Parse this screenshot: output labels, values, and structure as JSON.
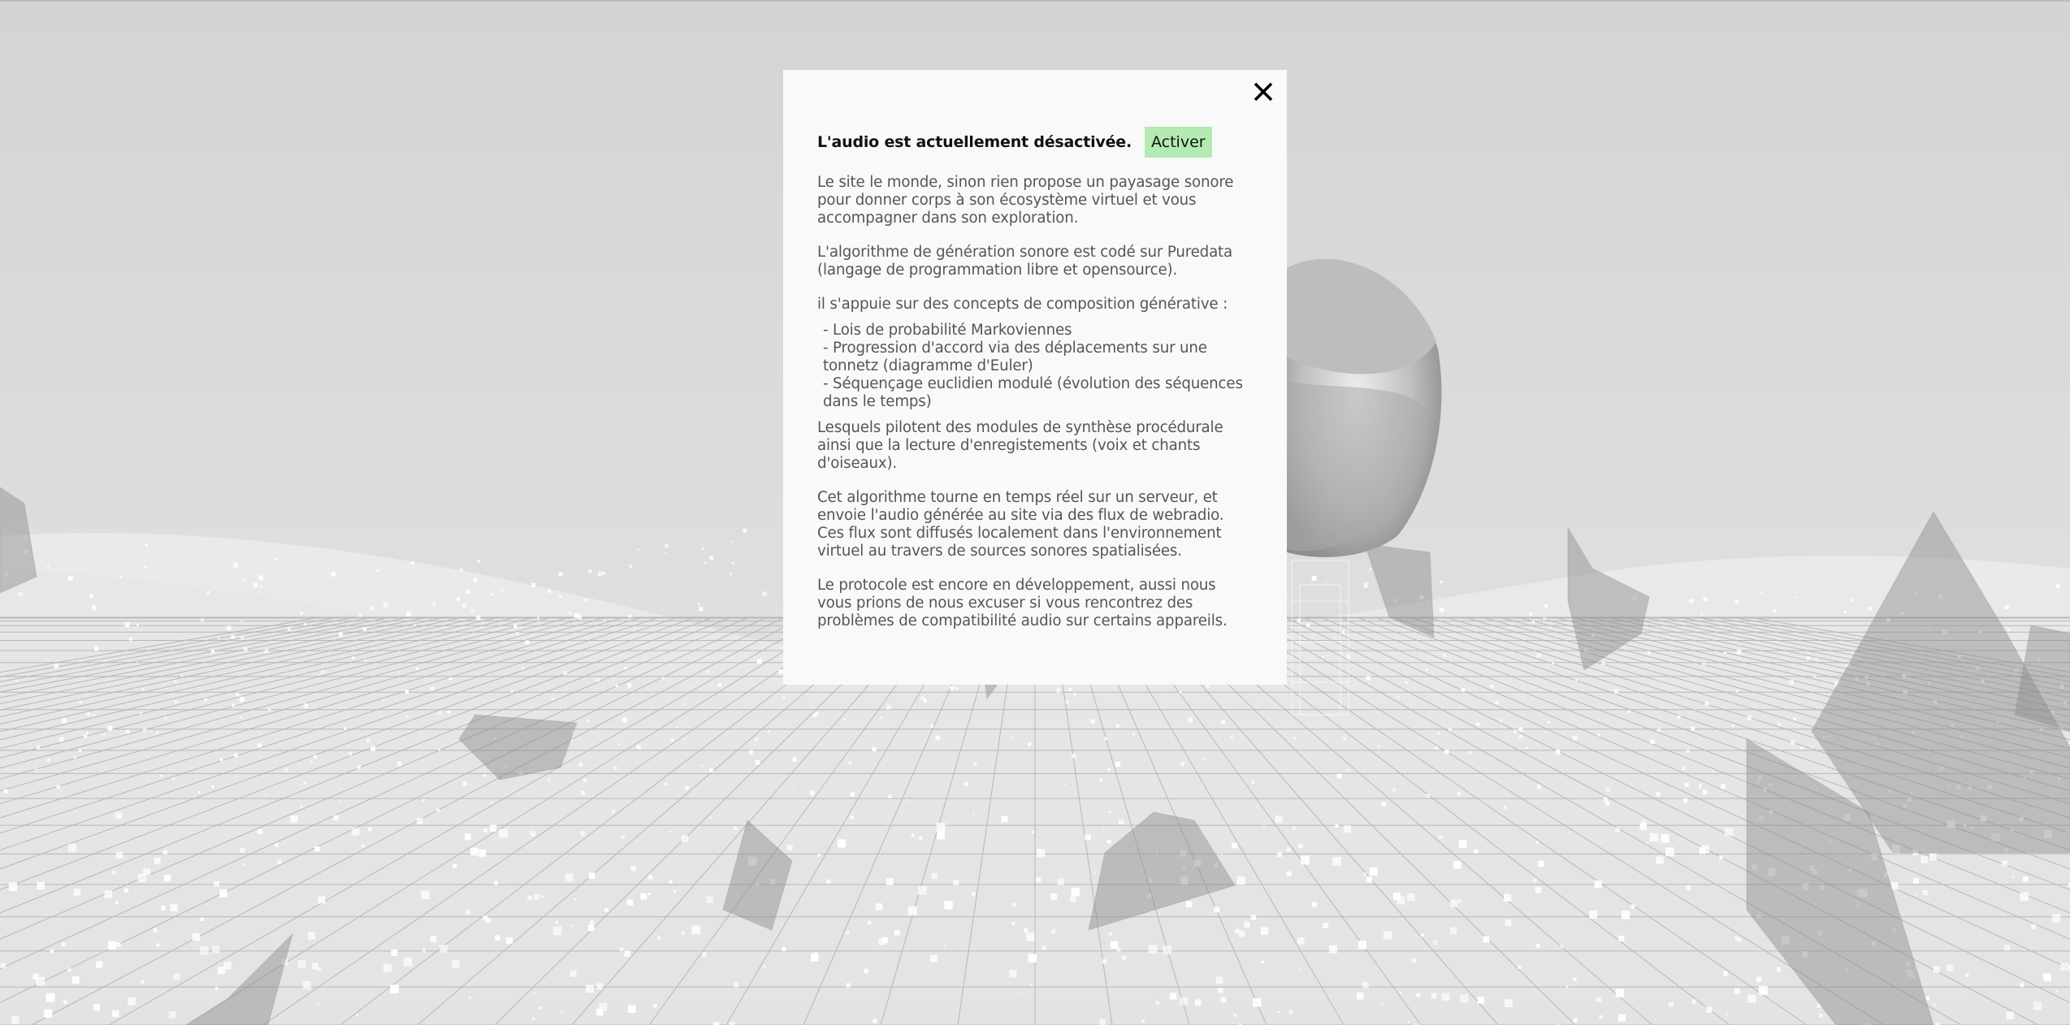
{
  "modal": {
    "close_label": "×",
    "audio_status": "L'audio est actuellement désactivée.",
    "activate_label": "Activer",
    "paragraphs": [
      "Le site le monde, sinon rien propose un payasage sonore pour donner corps à son écosystème virtuel et vous accompagner dans son exploration.",
      "L'algorithme de génération sonore est codé sur Puredata (langage de programmation libre et opensource).",
      "il s'appuie sur des concepts de composition générative :"
    ],
    "concepts": [
      "- Lois de probabilité Markoviennes",
      "- Progression d'accord via des déplacements sur une tonnetz (diagramme d'Euler)",
      "- Séquençage euclidien modulé (évolution des séquences dans le temps)"
    ],
    "paragraphs_after": [
      "Lesquels pilotent des modules de synthèse procédurale ainsi que la lecture d'enregistements (voix et chants d'oiseaux).",
      "Cet algorithme tourne en temps réel sur un serveur, et envoie l'audio générée au site via des flux de webradio. Ces flux sont diffusés localement dans l'environnement virtuel au travers de sources sonores spatialisées.",
      "Le protocole est encore en développement, aussi nous vous prions de nous excuser si vous rencontrez des problèmes de compatibilité audio sur certains appareils."
    ]
  },
  "colors": {
    "background": "#d9d9d9",
    "modal_bg": "#f9f9f9",
    "activate_bg": "#b3ebb3",
    "text": "#555555",
    "heading": "#111111"
  }
}
